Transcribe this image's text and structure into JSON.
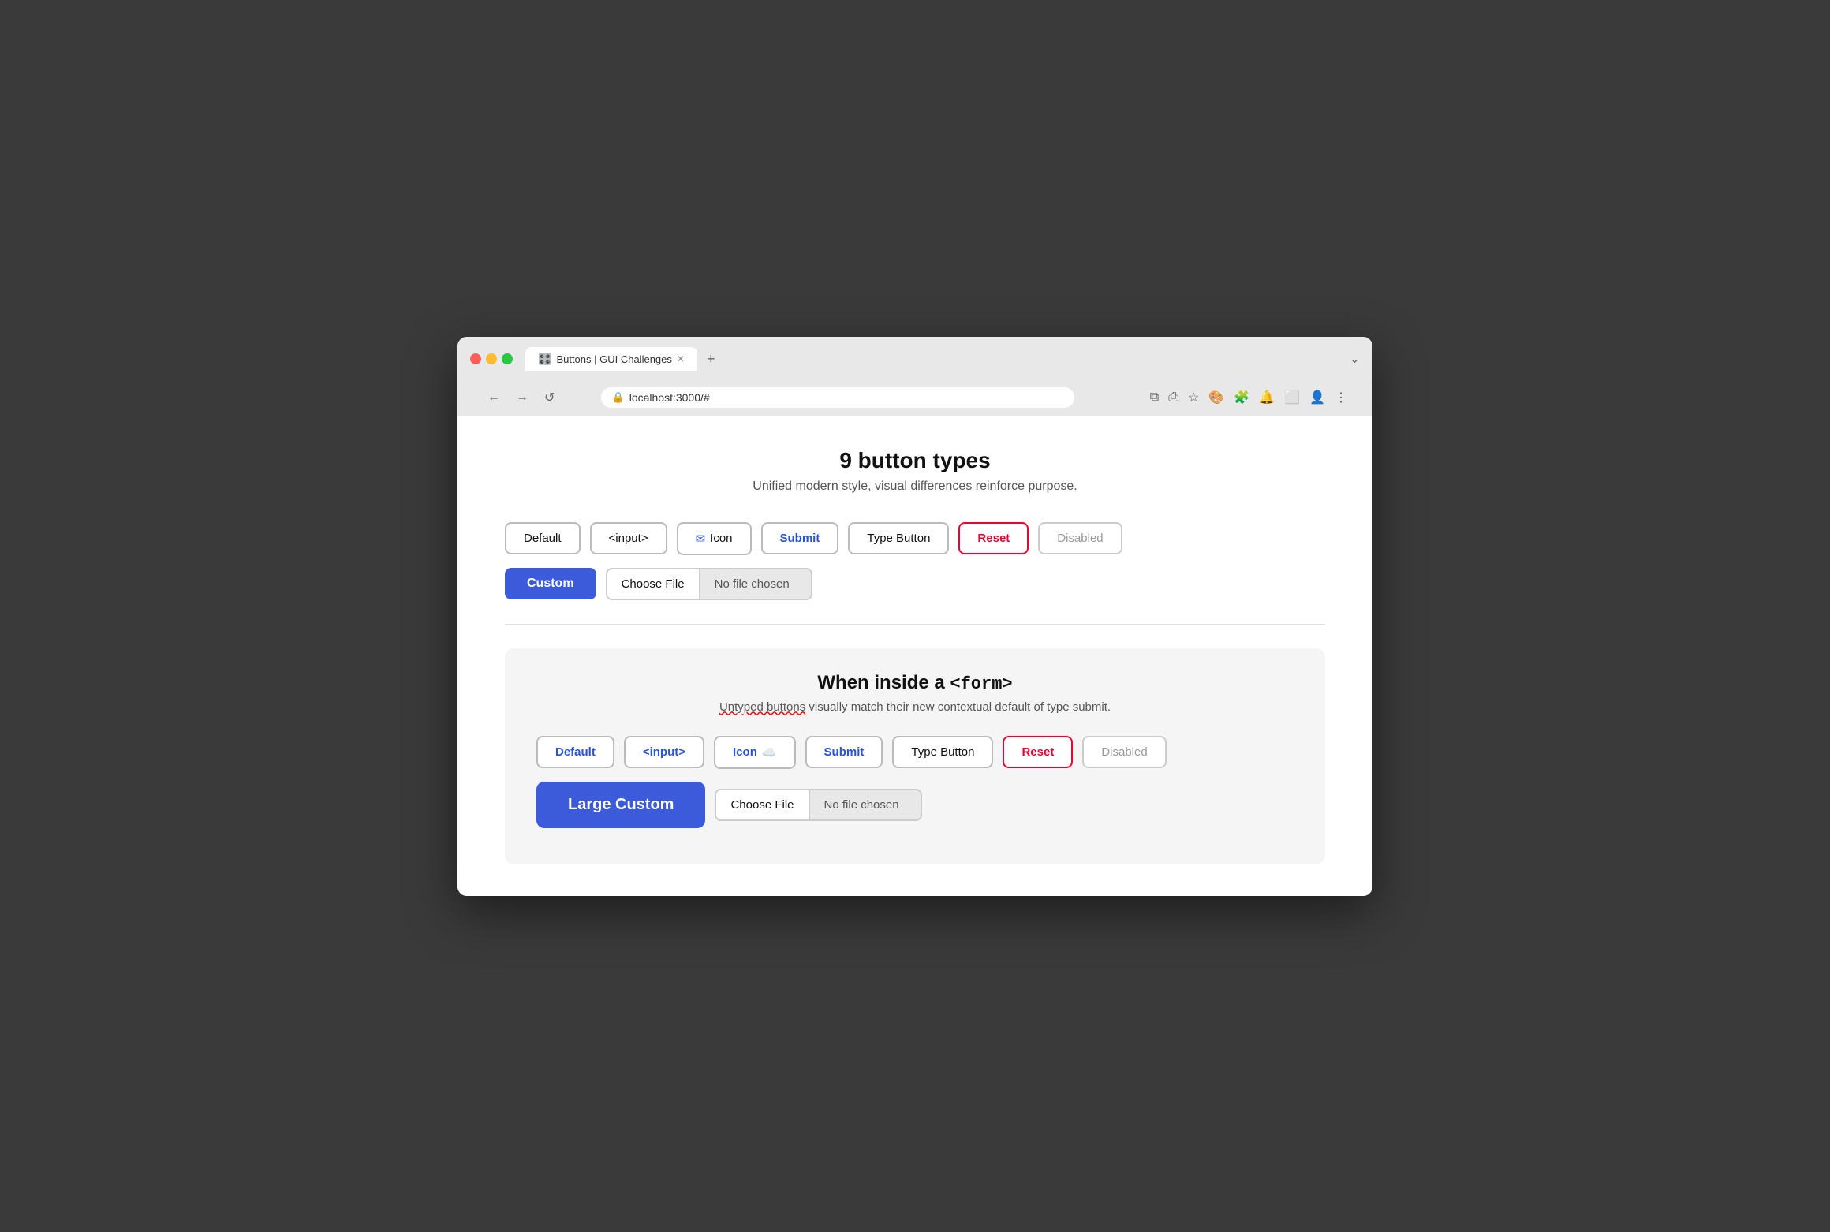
{
  "browser": {
    "traffic_lights": [
      "red",
      "yellow",
      "green"
    ],
    "tab": {
      "icon": "🎛️",
      "title": "Buttons | GUI Challenges",
      "close_icon": "✕"
    },
    "tab_new": "+",
    "tab_chevron": "⌄",
    "nav": {
      "back": "←",
      "forward": "→",
      "reload": "↺",
      "url": "localhost:3000/#"
    },
    "toolbar_icons": [
      "⧉",
      "⎙",
      "★",
      "🎨",
      "🧩",
      "🔔",
      "⬜",
      "👤",
      "⋮"
    ]
  },
  "page": {
    "title": "9 button types",
    "subtitle": "Unified modern style, visual differences reinforce purpose.",
    "buttons_row1": [
      {
        "label": "Default",
        "type": "default"
      },
      {
        "label": "<input>",
        "type": "input"
      },
      {
        "label": "Icon",
        "type": "icon",
        "icon": "mail"
      },
      {
        "label": "Submit",
        "type": "submit"
      },
      {
        "label": "Type Button",
        "type": "type-button"
      },
      {
        "label": "Reset",
        "type": "reset"
      },
      {
        "label": "Disabled",
        "type": "disabled"
      }
    ],
    "buttons_row2": [
      {
        "label": "Custom",
        "type": "custom"
      }
    ],
    "file_input": {
      "choose_label": "Choose File",
      "no_file_label": "No file chosen"
    },
    "form_section": {
      "title": "When inside a ",
      "title_code": "<form>",
      "subtitle_plain": " visually match their new contextual default of type submit.",
      "subtitle_underlined": "Untyped buttons",
      "buttons_row1": [
        {
          "label": "Default",
          "type": "form-default"
        },
        {
          "label": "<input>",
          "type": "form-input"
        },
        {
          "label": "Icon",
          "type": "form-icon",
          "icon": "cloud"
        },
        {
          "label": "Submit",
          "type": "form-submit"
        },
        {
          "label": "Type Button",
          "type": "form-type-button"
        },
        {
          "label": "Reset",
          "type": "form-reset"
        },
        {
          "label": "Disabled",
          "type": "form-disabled"
        }
      ],
      "large_custom_label": "Large Custom",
      "file_input": {
        "choose_label": "Choose File",
        "no_file_label": "No file chosen"
      }
    }
  }
}
